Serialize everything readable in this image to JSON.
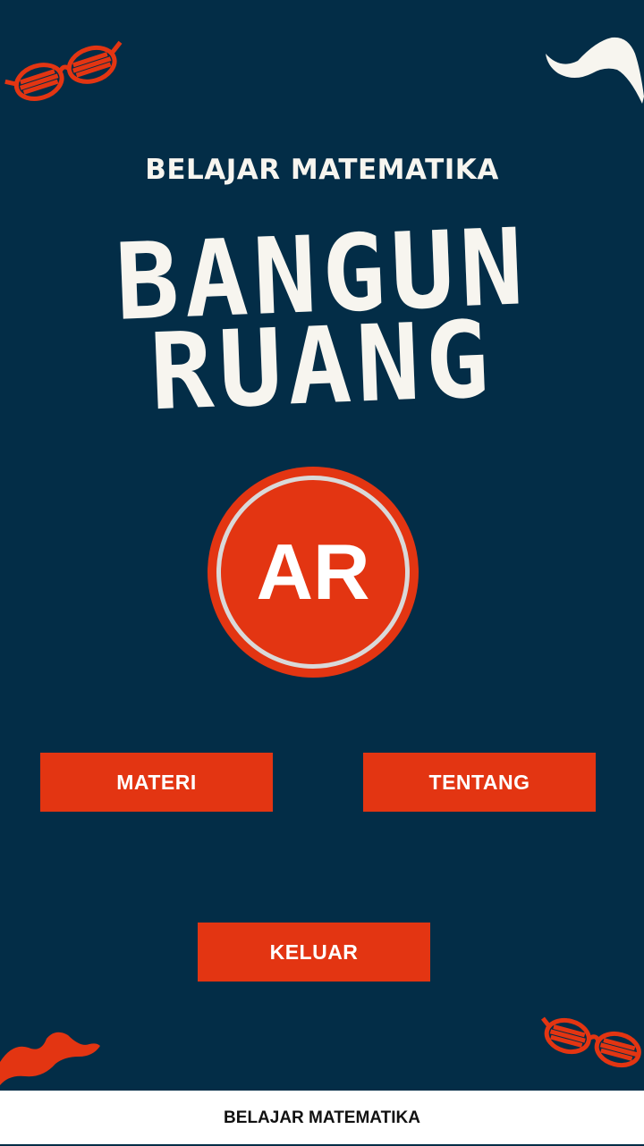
{
  "header": {
    "subtitle": "BELAJAR MATEMATIKA",
    "title_line1": "BANGUN",
    "title_line2": "RUANG"
  },
  "badge": {
    "label": "AR"
  },
  "buttons": {
    "materi": "MATERI",
    "tentang": "TENTANG",
    "keluar": "KELUAR"
  },
  "footer": {
    "text": "BELAJAR MATEMATIKA"
  },
  "colors": {
    "background": "#032d47",
    "accent": "#e33512",
    "text_light": "#f7f5ef",
    "footer_bg": "#ffffff"
  },
  "decorations": [
    "glasses-icon",
    "mustache-icon",
    "mustache-icon",
    "glasses-icon"
  ]
}
